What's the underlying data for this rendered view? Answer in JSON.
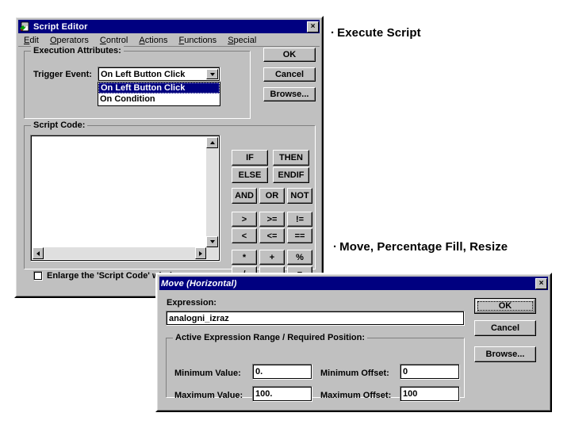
{
  "slide": {
    "background": "#ffffff",
    "bullets": [
      {
        "text": "Execute Script"
      },
      {
        "text": "Move, Percentage Fill, Resize"
      }
    ]
  },
  "script_editor": {
    "title": "Script Editor",
    "title_icon": "script-document-icon",
    "close_label": "×",
    "menu": [
      {
        "mnemonic": "E",
        "rest": "dit"
      },
      {
        "mnemonic": "O",
        "rest": "perators"
      },
      {
        "mnemonic": "C",
        "rest": "ontrol"
      },
      {
        "mnemonic": "A",
        "rest": "ctions"
      },
      {
        "mnemonic": "F",
        "rest": "unctions"
      },
      {
        "mnemonic": "S",
        "rest": "pecial"
      }
    ],
    "execution_attributes": {
      "group_label": "Execution Attributes:",
      "trigger_label": "Trigger Event:",
      "trigger_value": "On Left Button Click",
      "trigger_options": [
        "On Left Button Click",
        "On Condition"
      ],
      "selected_option_index": 0
    },
    "script_code": {
      "group_label": "Script Code:",
      "content": "",
      "enlarge_checkbox_label": "Enlarge the 'Script Code' window",
      "enlarge_checked": false
    },
    "buttons": {
      "ok": "OK",
      "cancel": "Cancel",
      "browse": "Browse..."
    },
    "operator_groups": [
      {
        "name": "conditional",
        "buttons": [
          "IF",
          "THEN",
          "ELSE",
          "ENDIF"
        ]
      },
      {
        "name": "logical",
        "buttons": [
          "AND",
          "OR",
          "NOT"
        ]
      },
      {
        "name": "comparison",
        "buttons": [
          ">",
          ">=",
          "!=",
          "<",
          "<=",
          "=="
        ]
      },
      {
        "name": "arithmetic",
        "buttons": [
          "*",
          "+",
          "%",
          "/",
          "-",
          "="
        ]
      }
    ]
  },
  "move_dialog": {
    "title": "Move (Horizontal)",
    "close_label": "×",
    "expression_label": "Expression:",
    "expression_value": "analogni_izraz",
    "range_group_label": "Active Expression Range / Required Position:",
    "fields": [
      {
        "label": "Minimum Value:",
        "value": "0."
      },
      {
        "label": "Minimum Offset:",
        "value": "0"
      },
      {
        "label": "Maximum Value:",
        "value": "100."
      },
      {
        "label": "Maximum Offset:",
        "value": "100"
      }
    ],
    "buttons": {
      "ok": "OK",
      "cancel": "Cancel",
      "browse": "Browse..."
    }
  },
  "colors": {
    "titlebar": "#000080",
    "face": "#c0c0c0",
    "highlight": "#ffffff",
    "shadow": "#808080",
    "dark": "#000000",
    "field_bg": "#ffffff"
  }
}
